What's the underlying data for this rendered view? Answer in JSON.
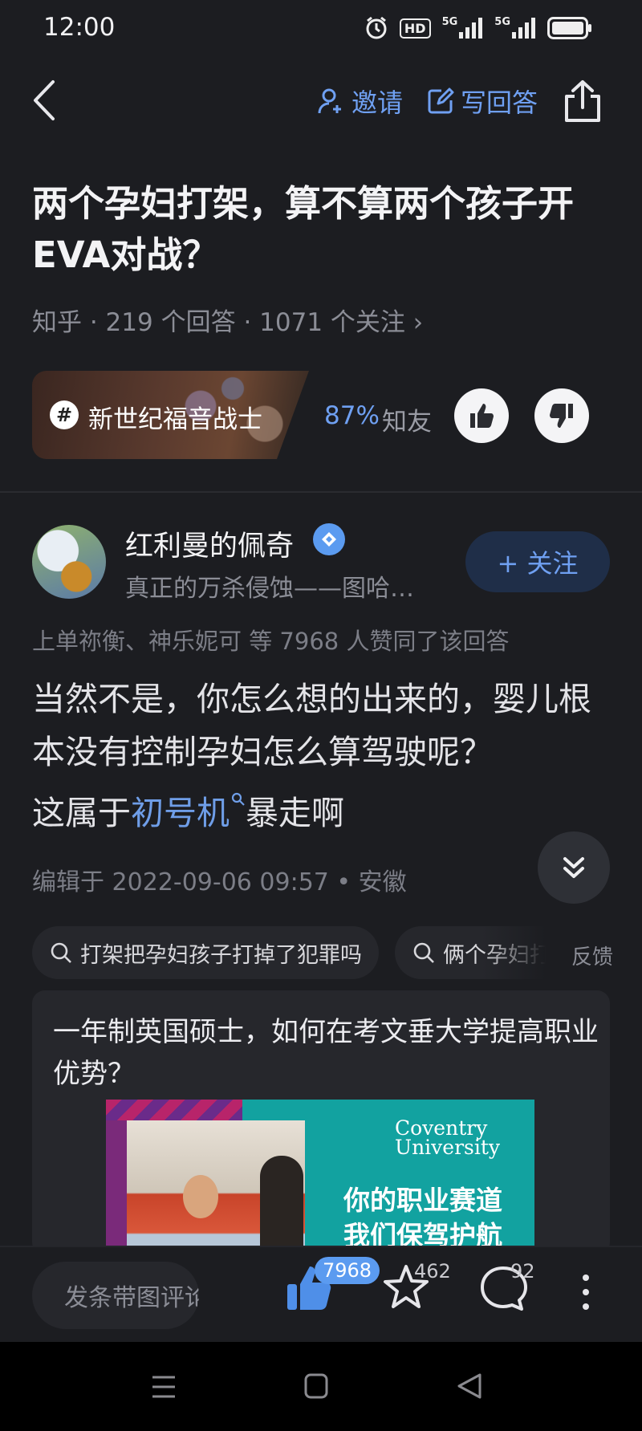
{
  "status_bar": {
    "time": "12:00",
    "hd_label": "HD",
    "signal_1": "5G",
    "signal_2": "5G"
  },
  "nav": {
    "invite_label": "邀请",
    "write_answer_label": "写回答"
  },
  "question": {
    "title": "两个孕妇打架，算不算两个孩子开EVA对战？",
    "meta": "知乎 · 219 个回答 · 1071 个关注 ›"
  },
  "topic": {
    "hash": "#",
    "name": "新世纪福音战士",
    "percent": "87%",
    "percent_suffix": "知友"
  },
  "author": {
    "name": "红利曼的佩奇",
    "bio": "真正的万杀侵蚀——图哈…",
    "follow_label": "+ 关注"
  },
  "answer": {
    "endorse_text": "上单祢衡、神乐妮可 等 7968 人赞同了该回答",
    "paragraph_1": "当然不是，你怎么想的出来的，婴儿根本没有控制孕妇怎么算驾驶呢？",
    "paragraph_2_pre": "这属于",
    "paragraph_2_link": "初号机",
    "paragraph_2_post": "暴走啊",
    "edited": "编辑于 2022-09-06 09:57 • 安徽"
  },
  "search_chips": [
    "打架把孕妇孩子打掉了犯罪吗",
    "俩个孕妇打"
  ],
  "feedback_label": "反馈",
  "ad": {
    "title": "一年制英国硕士，如何在考文垂大学提高职业优势？",
    "brand_line_1": "Coventry",
    "brand_line_2": "University",
    "slogan_line_1": "你的职业赛道",
    "slogan_line_2": "我们保驾护航"
  },
  "action_bar": {
    "comment_placeholder": "发条带图评论",
    "likes": "7968",
    "favorites": "462",
    "comments": "92"
  },
  "colors": {
    "accent": "#6fa0f2",
    "background": "#1c1d21",
    "card": "#26272c"
  }
}
